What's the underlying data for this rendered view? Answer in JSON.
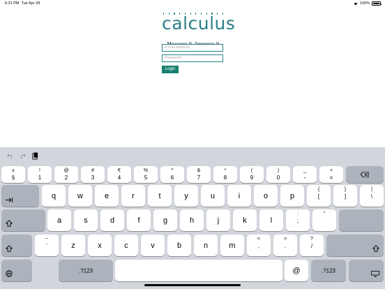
{
  "status": {
    "time": "6:31 PM",
    "date": "Tue Apr 28",
    "battery": "100%"
  },
  "logo": {
    "word": "calculus",
    "tagline": "Measure it. Improve it."
  },
  "form": {
    "email_placeholder": "e-mail address",
    "password_placeholder": "Password",
    "login_label": "Login"
  },
  "toolbar": {
    "undo_icon": "undo-icon",
    "redo_icon": "redo-icon",
    "paste_icon": "paste-icon"
  },
  "keyboard": {
    "row1": [
      {
        "t": "±",
        "b": "§"
      },
      {
        "t": "!",
        "b": "1"
      },
      {
        "t": "@",
        "b": "2"
      },
      {
        "t": "#",
        "b": "3"
      },
      {
        "t": "€",
        "b": "4"
      },
      {
        "t": "%",
        "b": "5"
      },
      {
        "t": "^",
        "b": "6"
      },
      {
        "t": "&",
        "b": "7"
      },
      {
        "t": "*",
        "b": "8"
      },
      {
        "t": "(",
        "b": "9"
      },
      {
        "t": ")",
        "b": "0"
      },
      {
        "t": "_",
        "b": "-"
      },
      {
        "t": "+",
        "b": "="
      }
    ],
    "row2": [
      "q",
      "w",
      "e",
      "r",
      "t",
      "y",
      "u",
      "i",
      "o",
      "p"
    ],
    "row2_extra": [
      {
        "t": "{",
        "b": "["
      },
      {
        "t": "}",
        "b": "]"
      },
      {
        "t": "|",
        "b": "\\"
      }
    ],
    "row3": [
      "a",
      "s",
      "d",
      "f",
      "g",
      "h",
      "j",
      "k",
      "l"
    ],
    "row3_extra": [
      {
        "t": ":",
        "b": ";"
      },
      {
        "t": "”",
        "b": ""
      }
    ],
    "row4_pre": {
      "t": "~",
      "b": "`"
    },
    "row4": [
      "z",
      "x",
      "c",
      "v",
      "b",
      "n",
      "m"
    ],
    "row4_extra": [
      {
        "t": "<",
        "b": ","
      },
      {
        "t": ">",
        "b": "."
      },
      {
        "t": "?",
        "b": "/"
      }
    ],
    "numkey_label": ".?123",
    "at_label": "@",
    "delete_icon": "delete-icon",
    "tab_icon": "tab-icon",
    "shift_icon": "shift-icon",
    "globe_icon": "globe-icon",
    "dismiss_icon": "keyboard-dismiss-icon"
  }
}
